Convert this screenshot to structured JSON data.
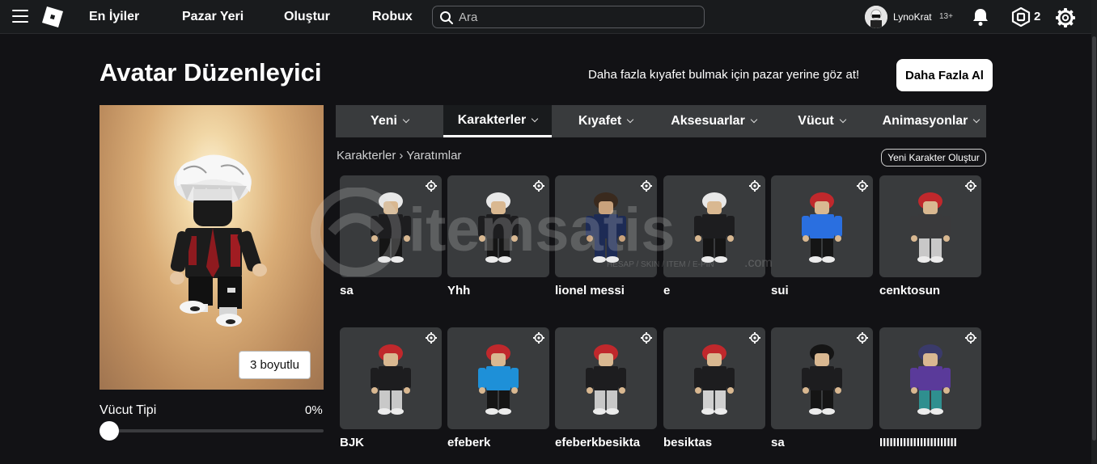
{
  "topbar": {
    "nav": [
      "En İyiler",
      "Pazar Yeri",
      "Oluştur",
      "Robux"
    ],
    "search_placeholder": "Ara",
    "user_name": "LynoKrat",
    "user_age": "13+",
    "robux_count": "2"
  },
  "header": {
    "title": "Avatar Düzenleyici",
    "promo_text": "Daha fazla kıyafet bulmak için pazar yerine göz at!",
    "more_button": "Daha Fazla Al"
  },
  "preview": {
    "view_button": "3 boyutlu",
    "body_type_label": "Vücut Tipi",
    "body_type_value": "0%"
  },
  "tabs": [
    "Yeni",
    "Karakterler",
    "Kıyafet",
    "Aksesuarlar",
    "Vücut",
    "Animasyonlar"
  ],
  "active_tab": "Karakterler",
  "breadcrumb": {
    "parent": "Karakterler",
    "current": "Yaratımlar"
  },
  "create_character_button": "Yeni Karakter Oluştur",
  "characters": [
    {
      "name": "sa",
      "hair": "#e8e8e8",
      "torso": "#1d1d1f",
      "legs": "#151515",
      "skin": "#d9b891"
    },
    {
      "name": "Yhh",
      "hair": "#e8e8e8",
      "torso": "#1d1d1f",
      "legs": "#151515",
      "skin": "#d9b891"
    },
    {
      "name": "lionel messi",
      "hair": "#3a2a1e",
      "torso": "#1d2b55",
      "legs": "#1d2b55",
      "skin": "#c9a27c"
    },
    {
      "name": "e",
      "hair": "#e8e8e8",
      "torso": "#1d1d1f",
      "legs": "#151515",
      "skin": "#d9b891"
    },
    {
      "name": "sui",
      "hair": "#c0282c",
      "torso": "#2a6fe0",
      "legs": "#151515",
      "skin": "#d9b891"
    },
    {
      "name": "cenktosun",
      "hair": "#c0282c",
      "torso": "#3a3a3c",
      "legs": "#c8c8c8",
      "skin": "#d9b891"
    },
    {
      "name": "BJK",
      "hair": "#c0282c",
      "torso": "#1d1d1f",
      "legs": "#c8c8c8",
      "skin": "#d9b891"
    },
    {
      "name": "efeberk",
      "hair": "#c0282c",
      "torso": "#1e90d8",
      "legs": "#151515",
      "skin": "#d9b891"
    },
    {
      "name": "efeberkbesikta",
      "hair": "#c0282c",
      "torso": "#1d1d1f",
      "legs": "#c8c8c8",
      "skin": "#d9b891"
    },
    {
      "name": "besiktas",
      "hair": "#c0282c",
      "torso": "#1d1d1f",
      "legs": "#d0d0d0",
      "skin": "#d9b891"
    },
    {
      "name": "sa",
      "hair": "#151515",
      "torso": "#1d1d1f",
      "legs": "#151515",
      "skin": "#d9b891"
    },
    {
      "name": "IIIIIIIIIIIIIIIIIIIIIII",
      "hair": "#3a3a6a",
      "torso": "#5a3a9a",
      "legs": "#2f8f8f",
      "skin": "#d9b891"
    }
  ],
  "colors": {
    "background": "#121215",
    "topbar": "#191b1d",
    "tabbar": "#393b3d",
    "card": "#393b3d"
  },
  "watermark": {
    "text": "itemsatis",
    "subtext": "HESAP / SKIN / ITEM / E-PIN",
    "suffix": ".com"
  }
}
